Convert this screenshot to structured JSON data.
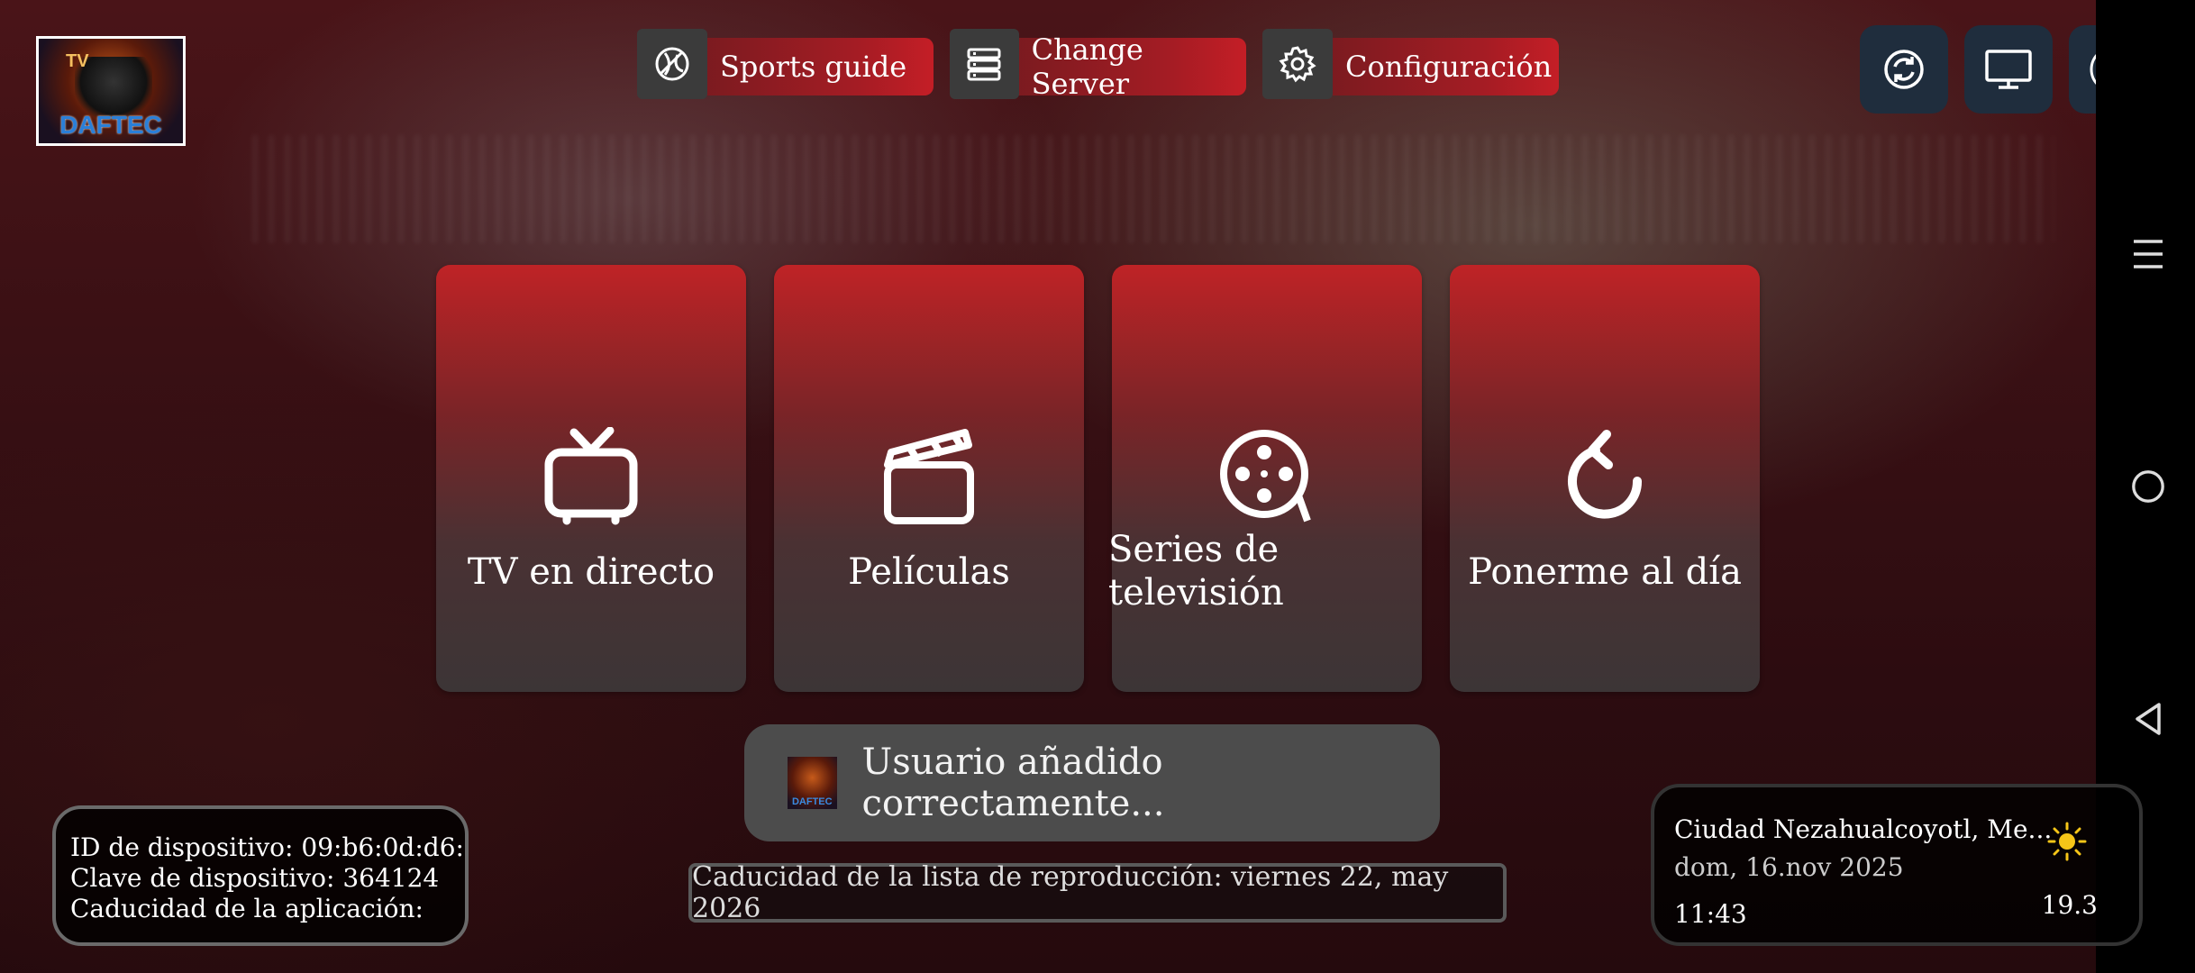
{
  "logo": {
    "brand": "DAFTEC",
    "tv_mark": "TV"
  },
  "top_buttons": [
    {
      "label": "Sports guide",
      "icon": "sports-ball-icon"
    },
    {
      "label": "Change Server",
      "icon": "server-list-icon"
    },
    {
      "label": "Configuración",
      "icon": "gear-icon"
    }
  ],
  "corner_buttons": [
    {
      "icon": "refresh-icon"
    },
    {
      "icon": "monitor-icon"
    },
    {
      "icon": "profile-icon"
    }
  ],
  "tiles": [
    {
      "label": "TV en directo",
      "icon": "tv-icon"
    },
    {
      "label": "Películas",
      "icon": "clapperboard-icon"
    },
    {
      "label": "Series de\ntelevisión",
      "icon": "film-reel-icon"
    },
    {
      "label": "Ponerme al día",
      "icon": "replay-icon"
    }
  ],
  "toast": {
    "message": "Usuario añadido correctamente...",
    "app_icon_label": "DAFTEC"
  },
  "device_info": {
    "device_id": "ID de dispositivo: 09:b6:0d:d6:...",
    "device_key": "Clave de dispositivo: 364124",
    "app_expiry": "Caducidad de la aplicación:"
  },
  "playlist_expiry": "Caducidad de la lista de reproducción: viernes 22, may 2026",
  "weather": {
    "city": "Ciudad Nezahualcoyotl, Me...",
    "date": "dom, 16.nov 2025",
    "time": "11:43",
    "temperature": "19.3",
    "icon": "sun-icon"
  },
  "system_nav": [
    "menu-icon",
    "home-circle-icon",
    "back-triangle-icon"
  ]
}
